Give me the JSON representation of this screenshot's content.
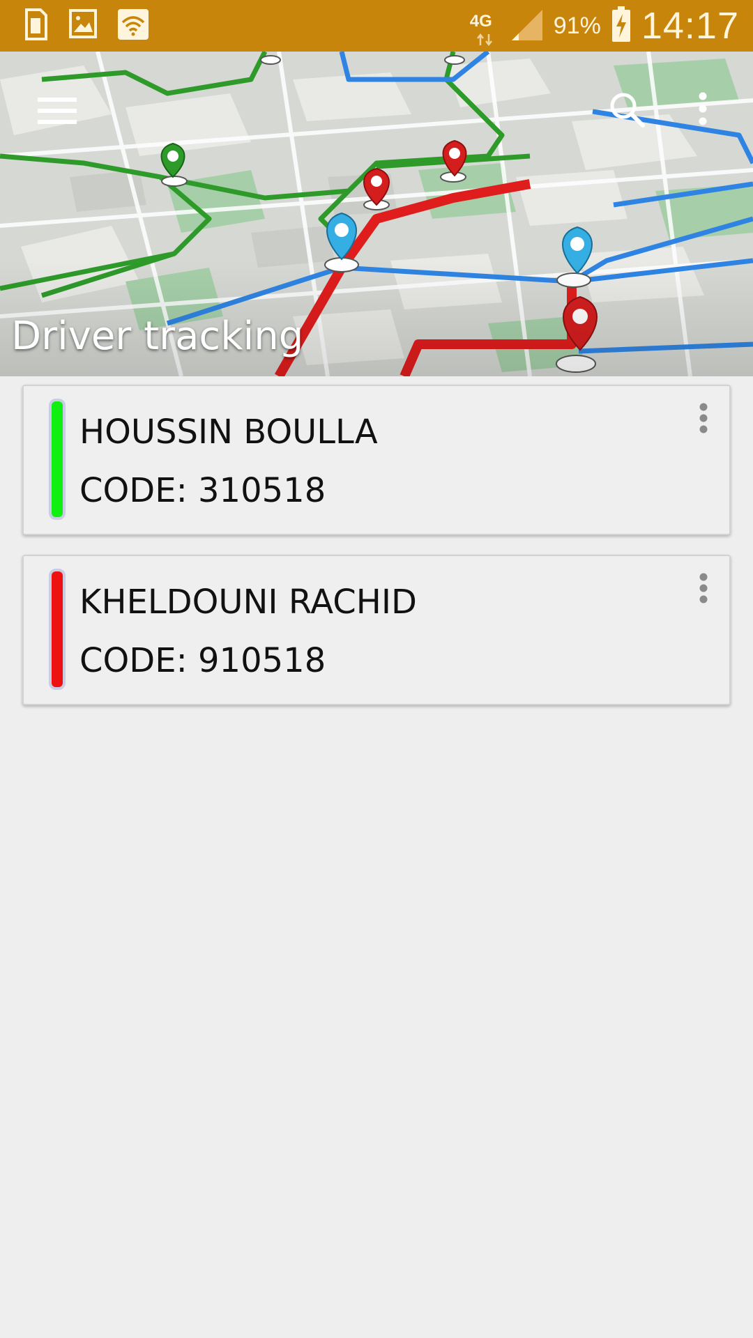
{
  "status_bar": {
    "network": "4G",
    "battery_percent": "91%",
    "time": "14:17",
    "icons": [
      "sim-card-icon",
      "image-notification-icon",
      "wifi-icon",
      "data-arrows-icon",
      "signal-icon",
      "battery-charging-icon"
    ],
    "color": "#c8850b"
  },
  "header": {
    "title": "Driver tracking",
    "icons": [
      "menu-icon",
      "search-icon",
      "more-vert-icon"
    ]
  },
  "drivers": [
    {
      "name": "HOUSSIN BOULLA",
      "code": "CODE: 310518",
      "status_color": "#11ee11",
      "icons": [
        "more-vert-icon"
      ]
    },
    {
      "name": "KHELDOUNI RACHID",
      "code": "CODE: 910518",
      "status_color": "#ee1111",
      "icons": [
        "more-vert-icon"
      ]
    }
  ]
}
